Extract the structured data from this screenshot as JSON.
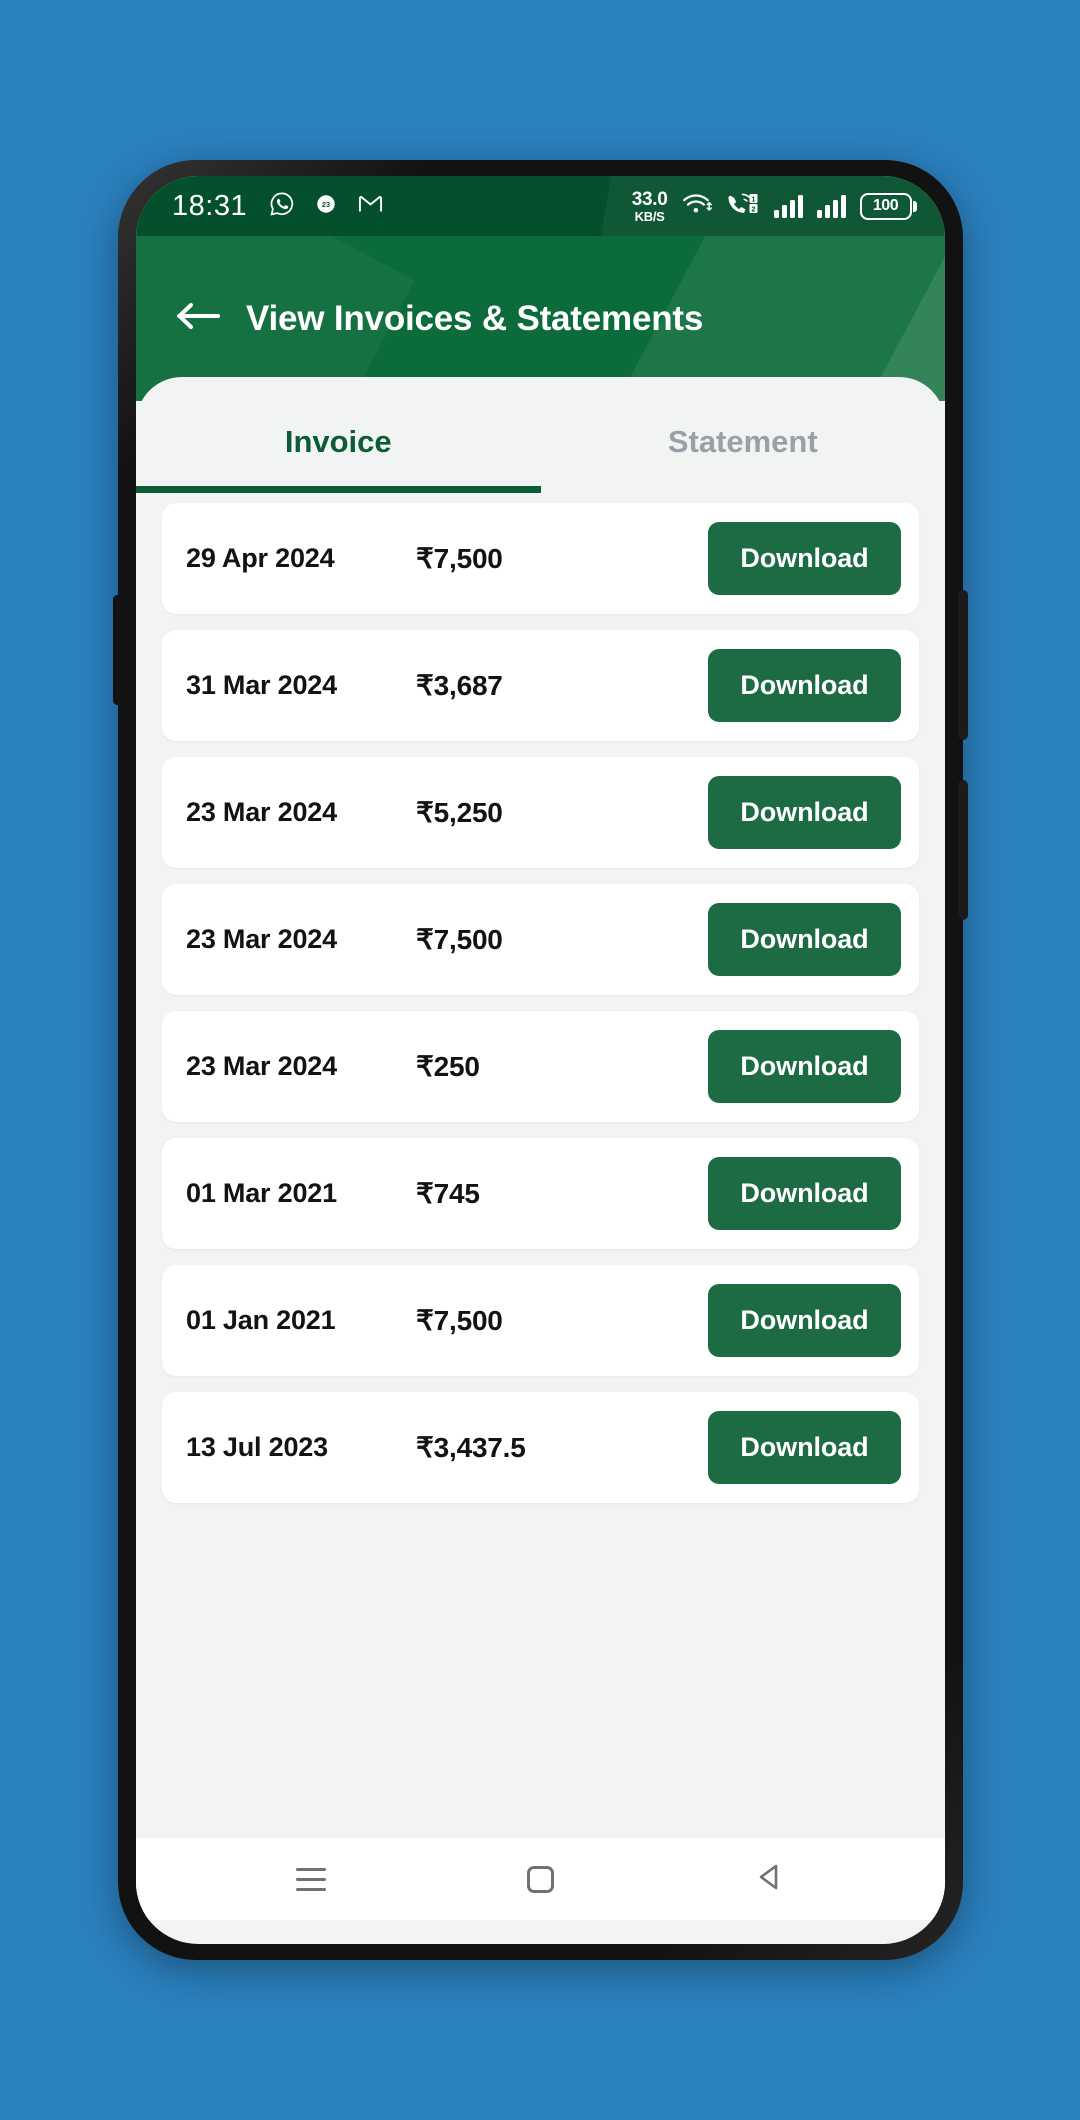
{
  "wallpaper_color": "#2B80BE",
  "theme": {
    "status_bar_bg": "#05502C",
    "appbar_bg": "#0B6B3A",
    "accent_green": "#0B5D34",
    "button_green": "#1D6B42",
    "sheet_bg": "#F2F3F3"
  },
  "status_bar": {
    "time": "18:31",
    "left_icons": [
      "whatsapp-icon",
      "clock-badge-icon",
      "gmail-icon"
    ],
    "net_speed_value": "33.0",
    "net_speed_unit": "KB/S",
    "right_icons": [
      "wifi-icon",
      "call-sim-icon",
      "signal-bars-sim1-icon",
      "signal-bars-sim2-icon"
    ],
    "battery_level": "100"
  },
  "appbar": {
    "back_icon": "arrow-left-icon",
    "title": "View Invoices & Statements"
  },
  "tabs": [
    {
      "label": "Invoice",
      "active": true
    },
    {
      "label": "Statement",
      "active": false
    }
  ],
  "list": {
    "download_label": "Download",
    "rows": [
      {
        "date": "29 Apr 2024",
        "amount": "₹7,500"
      },
      {
        "date": "31 Mar 2024",
        "amount": "₹3,687"
      },
      {
        "date": "23 Mar 2024",
        "amount": "₹5,250"
      },
      {
        "date": "23 Mar 2024",
        "amount": "₹7,500"
      },
      {
        "date": "23 Mar 2024",
        "amount": "₹250"
      },
      {
        "date": "01 Mar 2021",
        "amount": "₹745"
      },
      {
        "date": "01 Jan 2021",
        "amount": "₹7,500"
      },
      {
        "date": "13 Jul 2023",
        "amount": "₹3,437.5"
      }
    ]
  },
  "navbar": {
    "items": [
      "recents-icon",
      "home-icon",
      "back-triangle-icon"
    ]
  }
}
